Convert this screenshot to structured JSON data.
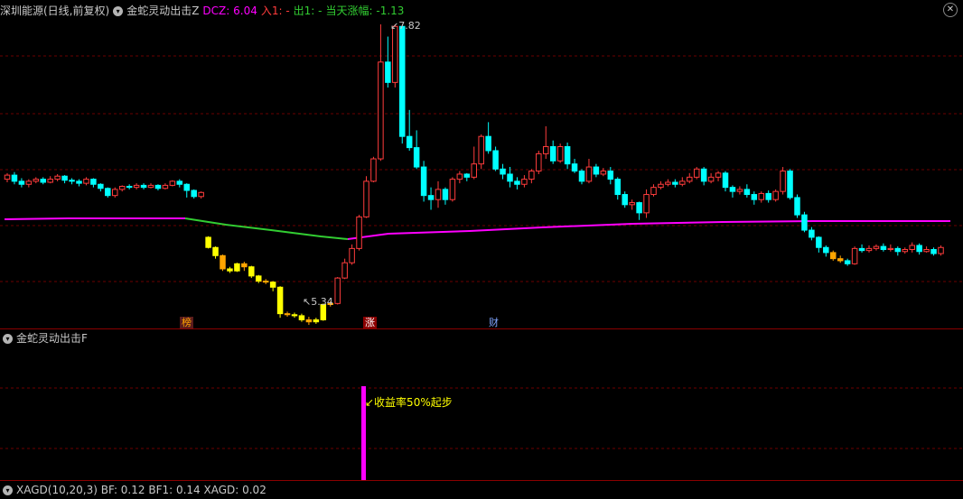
{
  "colors": {
    "up": "#ff3c3c",
    "down": "#00ffff",
    "yellow": "#ffff00",
    "orange": "#ffa500",
    "magenta": "#ff00ff",
    "green": "#32cd32",
    "grid": "#6b0000",
    "divider": "#8b0000",
    "text": "#c8c8c8",
    "dcz": "#ff00ff",
    "entry": "#ff3c3c",
    "exit": "#32cd32"
  },
  "main_header": {
    "stock": "深圳能源(日线,前复权)",
    "indicator": "金蛇灵动出击Z",
    "dcz": "DCZ: 6.04",
    "entry": "入1: -",
    "exit": "出1: -",
    "change": "当天涨幅: -1.13"
  },
  "sub_header": {
    "indicator": "金蛇灵动出击F"
  },
  "bottom_header": {
    "text": "XAGD(10,20,3) BF: 0.12 BF1: 0.14 XAGD: 0.02"
  },
  "annotations": {
    "high": "7.82",
    "low": "5.34",
    "yield_note": "收益率50%起步"
  },
  "markers": {
    "bang": "榜",
    "zhang": "涨",
    "cai": "财"
  },
  "chart_data": {
    "type": "candlestick",
    "high_label": 7.82,
    "low_label": 5.34,
    "candles": [
      [
        6.3,
        6.34,
        6.36,
        6.27
      ],
      [
        6.34,
        6.28,
        6.37,
        6.25
      ],
      [
        6.28,
        6.25,
        6.31,
        6.22
      ],
      [
        6.25,
        6.28,
        6.3,
        6.22
      ],
      [
        6.28,
        6.3,
        6.32,
        6.26
      ],
      [
        6.3,
        6.27,
        6.32,
        6.25
      ],
      [
        6.27,
        6.3,
        6.33,
        6.26
      ],
      [
        6.3,
        6.33,
        6.35,
        6.28
      ],
      [
        6.33,
        6.29,
        6.34,
        6.26
      ],
      [
        6.29,
        6.28,
        6.31,
        6.25
      ],
      [
        6.28,
        6.26,
        6.3,
        6.23
      ],
      [
        6.26,
        6.3,
        6.32,
        6.24
      ],
      [
        6.3,
        6.25,
        6.31,
        6.22
      ],
      [
        6.25,
        6.21,
        6.26,
        6.18
      ],
      [
        6.21,
        6.14,
        6.22,
        6.12
      ],
      [
        6.14,
        6.2,
        6.22,
        6.12
      ],
      [
        6.2,
        6.23,
        6.24,
        6.18
      ],
      [
        6.23,
        6.22,
        6.25,
        6.2
      ],
      [
        6.22,
        6.24,
        6.26,
        6.2
      ],
      [
        6.24,
        6.22,
        6.26,
        6.2
      ],
      [
        6.22,
        6.24,
        6.26,
        6.21
      ],
      [
        6.24,
        6.21,
        6.25,
        6.19
      ],
      [
        6.21,
        6.24,
        6.26,
        6.2
      ],
      [
        6.24,
        6.28,
        6.29,
        6.23
      ],
      [
        6.28,
        6.25,
        6.3,
        6.22
      ],
      [
        6.25,
        6.19,
        6.26,
        6.12
      ],
      [
        6.19,
        6.13,
        6.2,
        6.11
      ],
      [
        6.13,
        6.17,
        6.18,
        6.11
      ],
      [
        5.73,
        5.63,
        5.74,
        5.62
      ],
      [
        5.63,
        5.55,
        5.64,
        5.52
      ],
      [
        5.55,
        5.42,
        5.56,
        5.4
      ],
      [
        5.42,
        5.4,
        5.44,
        5.38
      ],
      [
        5.4,
        5.47,
        5.48,
        5.39
      ],
      [
        5.47,
        5.44,
        5.49,
        5.4
      ],
      [
        5.44,
        5.35,
        5.45,
        5.33
      ],
      [
        5.35,
        5.3,
        5.36,
        5.28
      ],
      [
        5.3,
        5.29,
        5.32,
        5.27
      ],
      [
        5.29,
        5.24,
        5.3,
        5.2
      ],
      [
        5.24,
        4.98,
        5.25,
        4.94
      ],
      [
        4.98,
        4.97,
        5.0,
        4.95
      ],
      [
        4.97,
        4.96,
        4.99,
        4.94
      ],
      [
        4.96,
        4.92,
        4.98,
        4.9
      ],
      [
        4.92,
        4.9,
        4.95,
        4.87
      ],
      [
        4.9,
        4.92,
        4.94,
        4.88
      ],
      [
        4.92,
        5.07,
        5.08,
        4.91
      ],
      [
        5.07,
        5.08,
        5.1,
        5.05
      ],
      [
        5.08,
        5.33,
        5.34,
        5.07
      ],
      [
        5.33,
        5.48,
        5.52,
        5.32
      ],
      [
        5.48,
        5.62,
        5.66,
        5.46
      ],
      [
        5.62,
        5.93,
        5.95,
        5.6
      ],
      [
        5.93,
        6.28,
        6.33,
        5.92
      ],
      [
        6.28,
        6.5,
        6.52,
        6.27
      ],
      [
        6.5,
        7.45,
        7.82,
        6.48
      ],
      [
        7.45,
        7.25,
        7.7,
        7.2
      ],
      [
        7.25,
        7.8,
        7.82,
        7.2
      ],
      [
        7.8,
        6.72,
        7.05,
        6.65
      ],
      [
        6.72,
        6.61,
        6.98,
        6.58
      ],
      [
        6.61,
        6.42,
        6.78,
        6.4
      ],
      [
        6.42,
        6.14,
        6.48,
        6.08
      ],
      [
        6.14,
        6.1,
        6.22,
        6.0
      ],
      [
        6.1,
        6.2,
        6.28,
        6.02
      ],
      [
        6.2,
        6.1,
        6.22,
        6.05
      ],
      [
        6.1,
        6.3,
        6.32,
        6.08
      ],
      [
        6.3,
        6.35,
        6.38,
        6.26
      ],
      [
        6.35,
        6.32,
        6.36,
        6.28
      ],
      [
        6.32,
        6.45,
        6.62,
        6.3
      ],
      [
        6.45,
        6.72,
        6.74,
        6.4
      ],
      [
        6.72,
        6.58,
        6.86,
        6.55
      ],
      [
        6.58,
        6.4,
        6.62,
        6.38
      ],
      [
        6.4,
        6.35,
        6.45,
        6.3
      ],
      [
        6.35,
        6.28,
        6.42,
        6.22
      ],
      [
        6.28,
        6.25,
        6.32,
        6.2
      ],
      [
        6.25,
        6.3,
        6.34,
        6.22
      ],
      [
        6.3,
        6.38,
        6.4,
        6.26
      ],
      [
        6.38,
        6.55,
        6.58,
        6.35
      ],
      [
        6.55,
        6.62,
        6.82,
        6.5
      ],
      [
        6.62,
        6.48,
        6.68,
        6.45
      ],
      [
        6.48,
        6.62,
        6.65,
        6.46
      ],
      [
        6.62,
        6.45,
        6.66,
        6.4
      ],
      [
        6.45,
        6.38,
        6.5,
        6.36
      ],
      [
        6.38,
        6.28,
        6.4,
        6.25
      ],
      [
        6.28,
        6.42,
        6.5,
        6.26
      ],
      [
        6.42,
        6.35,
        6.45,
        6.32
      ],
      [
        6.35,
        6.38,
        6.41,
        6.33
      ],
      [
        6.38,
        6.3,
        6.42,
        6.25
      ],
      [
        6.3,
        6.15,
        6.32,
        6.1
      ],
      [
        6.15,
        6.05,
        6.18,
        6.02
      ],
      [
        6.05,
        6.07,
        6.1,
        6.0
      ],
      [
        6.07,
        5.97,
        6.08,
        5.9
      ],
      [
        5.97,
        6.15,
        6.2,
        5.92
      ],
      [
        6.15,
        6.22,
        6.25,
        6.13
      ],
      [
        6.22,
        6.25,
        6.28,
        6.2
      ],
      [
        6.25,
        6.27,
        6.3,
        6.23
      ],
      [
        6.27,
        6.25,
        6.3,
        6.22
      ],
      [
        6.25,
        6.28,
        6.32,
        6.23
      ],
      [
        6.28,
        6.32,
        6.36,
        6.26
      ],
      [
        6.32,
        6.4,
        6.42,
        6.3
      ],
      [
        6.4,
        6.28,
        6.42,
        6.24
      ],
      [
        6.28,
        6.32,
        6.36,
        6.26
      ],
      [
        6.32,
        6.36,
        6.38,
        6.28
      ],
      [
        6.36,
        6.22,
        6.38,
        6.18
      ],
      [
        6.22,
        6.18,
        6.24,
        6.12
      ],
      [
        6.18,
        6.2,
        6.23,
        6.15
      ],
      [
        6.2,
        6.15,
        6.25,
        6.12
      ],
      [
        6.15,
        6.1,
        6.18,
        6.05
      ],
      [
        6.1,
        6.16,
        6.18,
        6.07
      ],
      [
        6.16,
        6.1,
        6.19,
        6.07
      ],
      [
        6.1,
        6.18,
        6.2,
        6.08
      ],
      [
        6.18,
        6.38,
        6.42,
        6.15
      ],
      [
        6.38,
        6.12,
        6.4,
        6.1
      ],
      [
        6.12,
        5.95,
        6.15,
        5.92
      ],
      [
        5.95,
        5.8,
        5.98,
        5.78
      ],
      [
        5.8,
        5.73,
        5.83,
        5.7
      ],
      [
        5.73,
        5.63,
        5.74,
        5.58
      ],
      [
        5.63,
        5.58,
        5.65,
        5.54
      ],
      [
        5.58,
        5.52,
        5.6,
        5.5
      ],
      [
        5.52,
        5.5,
        5.55,
        5.48
      ],
      [
        5.5,
        5.47,
        5.52,
        5.45
      ],
      [
        5.47,
        5.62,
        5.64,
        5.46
      ],
      [
        5.62,
        5.6,
        5.66,
        5.58
      ],
      [
        5.6,
        5.62,
        5.65,
        5.58
      ],
      [
        5.62,
        5.64,
        5.66,
        5.6
      ],
      [
        5.64,
        5.61,
        5.67,
        5.59
      ],
      [
        5.61,
        5.62,
        5.66,
        5.59
      ],
      [
        5.62,
        5.59,
        5.64,
        5.55
      ],
      [
        5.59,
        5.61,
        5.63,
        5.57
      ],
      [
        5.61,
        5.65,
        5.68,
        5.58
      ],
      [
        5.65,
        5.59,
        5.67,
        5.56
      ],
      [
        5.59,
        5.61,
        5.64,
        5.58
      ],
      [
        5.61,
        5.57,
        5.63,
        5.55
      ],
      [
        5.57,
        5.63,
        5.65,
        5.55
      ]
    ]
  }
}
